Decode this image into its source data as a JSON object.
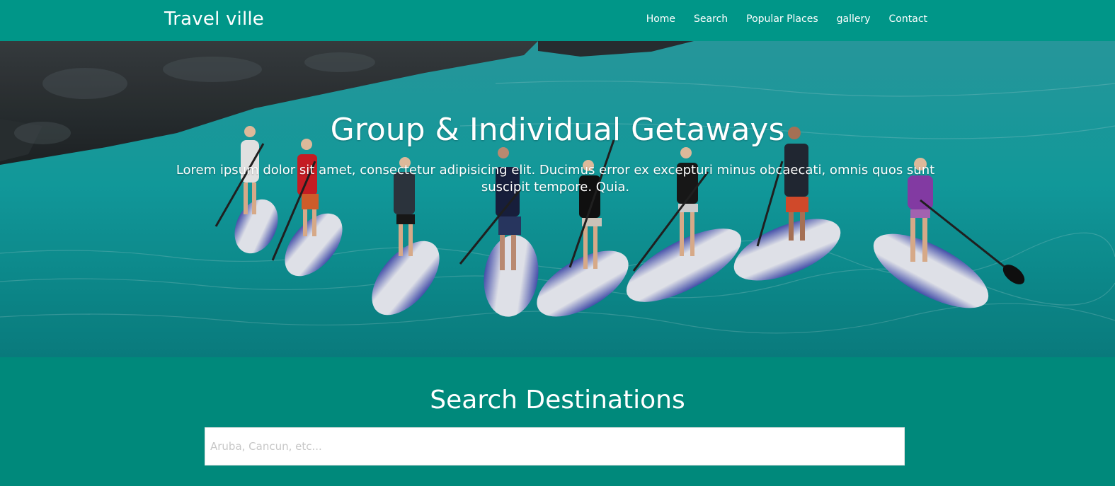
{
  "brand": {
    "name": "Travel ville"
  },
  "nav": {
    "items": [
      {
        "label": "Home"
      },
      {
        "label": "Search"
      },
      {
        "label": "Popular Places"
      },
      {
        "label": "gallery"
      },
      {
        "label": "Contact"
      }
    ]
  },
  "hero": {
    "title": "Group & Individual Getaways",
    "text": "Lorem ipsum dolor sit amet, consectetur adipisicing elit. Ducimus error ex excepturi minus obcaecati, omnis quos sunt suscipit tempore. Quia."
  },
  "search": {
    "title": "Search Destinations",
    "placeholder": "Aruba, Cancun, etc...",
    "value": ""
  },
  "colors": {
    "navbar": "#009688",
    "section": "#00897b",
    "text": "#ffffff"
  }
}
